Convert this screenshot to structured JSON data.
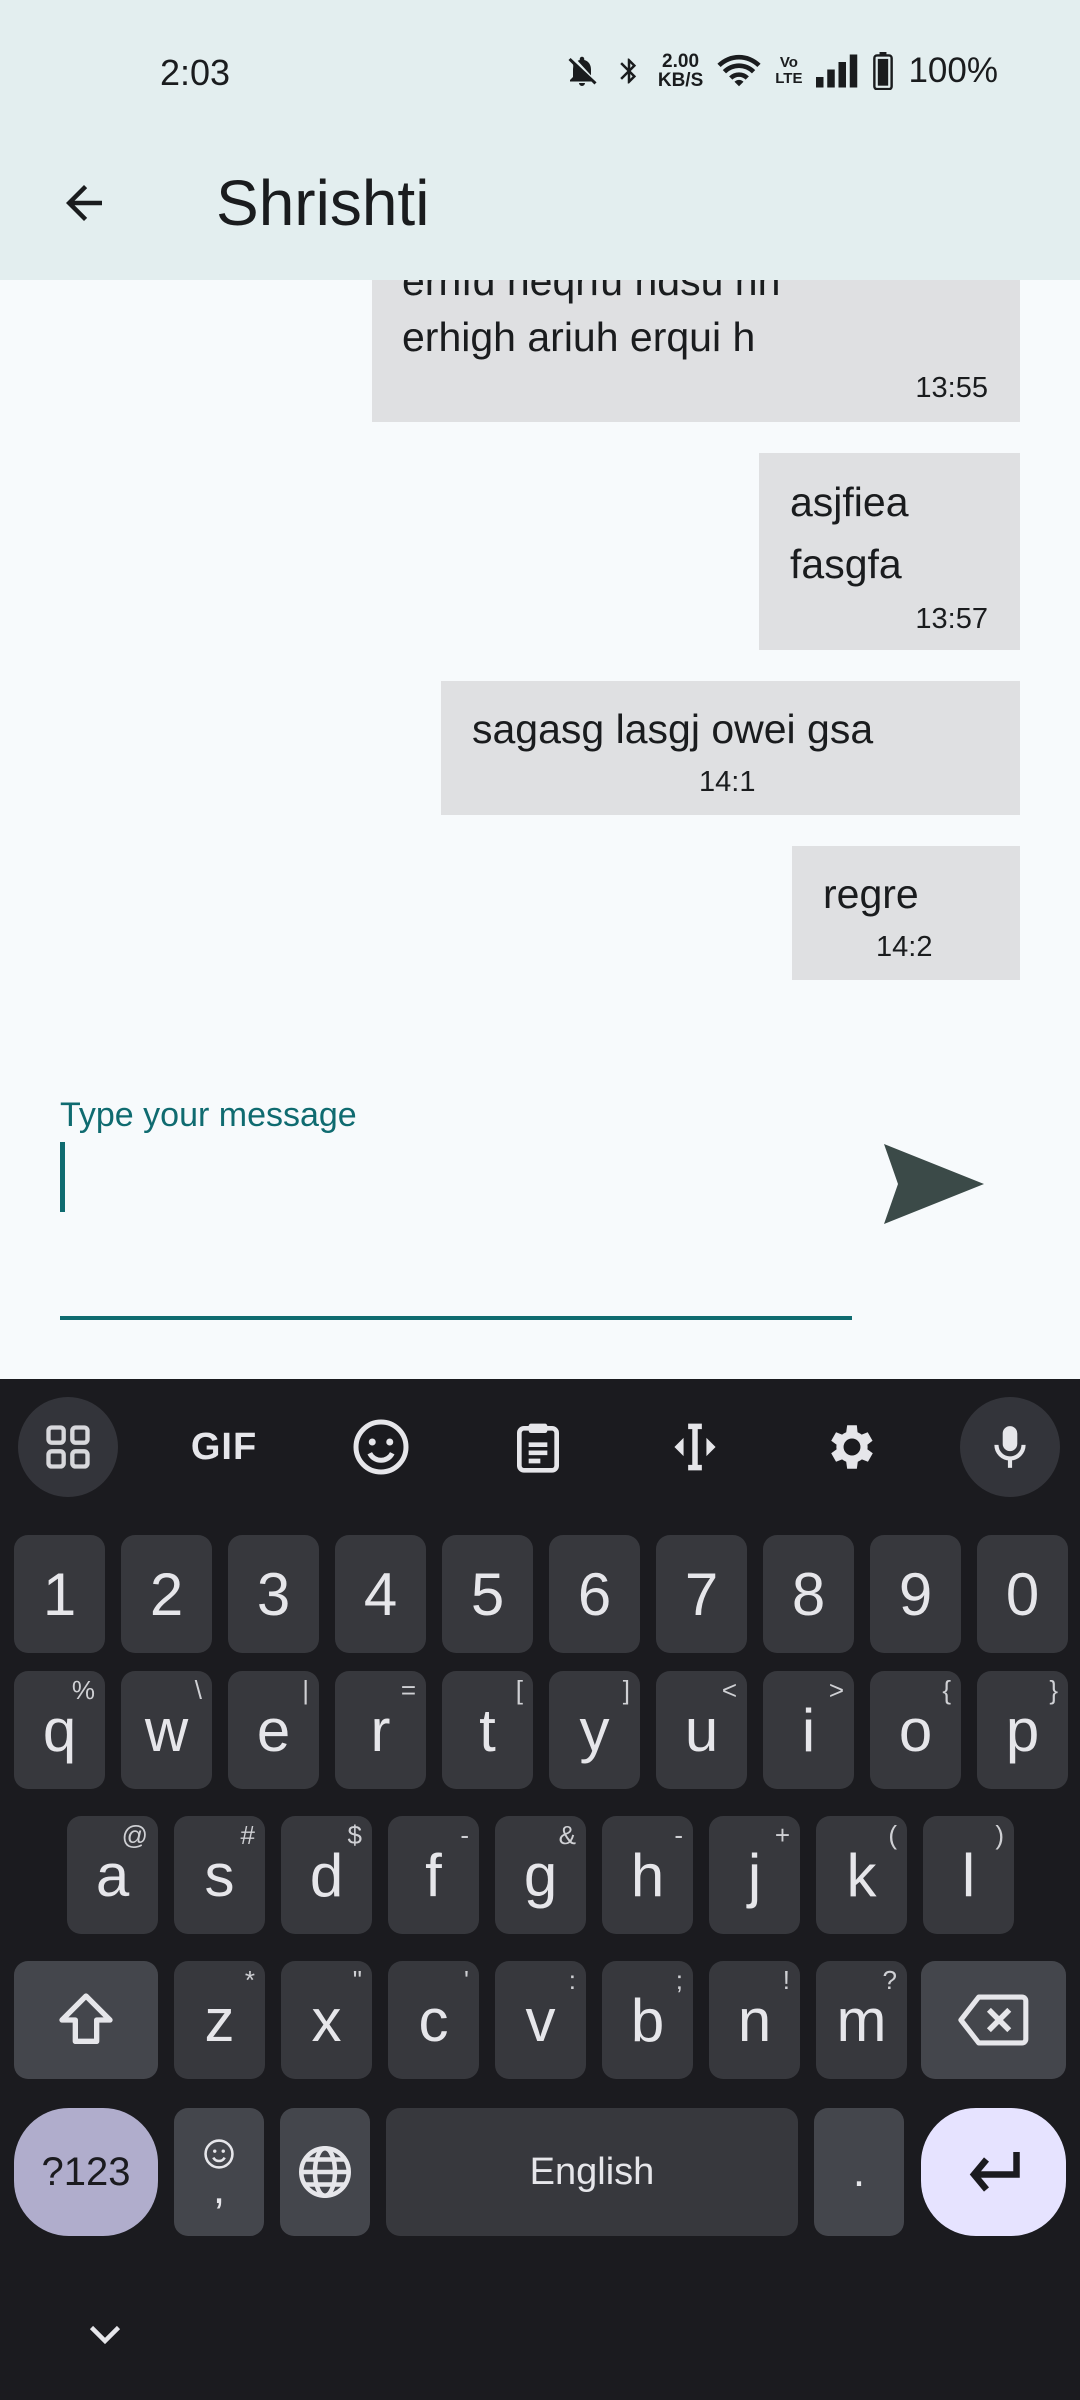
{
  "status_bar": {
    "time": "2:03",
    "net_speed_value": "2.00",
    "net_speed_unit": "KB/S",
    "volte_top": "Vo",
    "volte_bottom": "LTE",
    "battery": "100%"
  },
  "app_bar": {
    "title": "Shrishti"
  },
  "messages": [
    {
      "text": "erhigh ariuh erqui h",
      "partial_top": "erhfd heqrfu hdsu hh",
      "time": "13:55"
    },
    {
      "text": "asjfiea\nfasgfa",
      "time": "13:57"
    },
    {
      "text": "sagasg lasgj owei gsa",
      "time": "14:1"
    },
    {
      "text": "regre",
      "time": "14:2"
    }
  ],
  "composer": {
    "label": "Type your message",
    "value": ""
  },
  "keyboard": {
    "toolbar": [
      "apps-icon",
      "gif-icon",
      "emoji-icon",
      "clipboard-icon",
      "cursor-icon",
      "settings-icon",
      "mic-icon"
    ],
    "gif_label": "GIF",
    "row_numbers": [
      "1",
      "2",
      "3",
      "4",
      "5",
      "6",
      "7",
      "8",
      "9",
      "0"
    ],
    "row_q": [
      {
        "k": "q",
        "h": "%"
      },
      {
        "k": "w",
        "h": "\\"
      },
      {
        "k": "e",
        "h": "|"
      },
      {
        "k": "r",
        "h": "="
      },
      {
        "k": "t",
        "h": "["
      },
      {
        "k": "y",
        "h": "]"
      },
      {
        "k": "u",
        "h": "<"
      },
      {
        "k": "i",
        "h": ">"
      },
      {
        "k": "o",
        "h": "{"
      },
      {
        "k": "p",
        "h": "}"
      }
    ],
    "row_a": [
      {
        "k": "a",
        "h": "@"
      },
      {
        "k": "s",
        "h": "#"
      },
      {
        "k": "d",
        "h": "$"
      },
      {
        "k": "f",
        "h": "-"
      },
      {
        "k": "g",
        "h": "&"
      },
      {
        "k": "h",
        "h": "-"
      },
      {
        "k": "j",
        "h": "+"
      },
      {
        "k": "k",
        "h": "("
      },
      {
        "k": "l",
        "h": ")"
      }
    ],
    "row_z": [
      {
        "k": "z",
        "h": "*"
      },
      {
        "k": "x",
        "h": "\""
      },
      {
        "k": "c",
        "h": "'"
      },
      {
        "k": "v",
        "h": ":"
      },
      {
        "k": "b",
        "h": ";"
      },
      {
        "k": "n",
        "h": "!"
      },
      {
        "k": "m",
        "h": "?"
      }
    ],
    "symbols_label": "?123",
    "comma_label": ",",
    "space_label": "English",
    "period_label": "."
  }
}
